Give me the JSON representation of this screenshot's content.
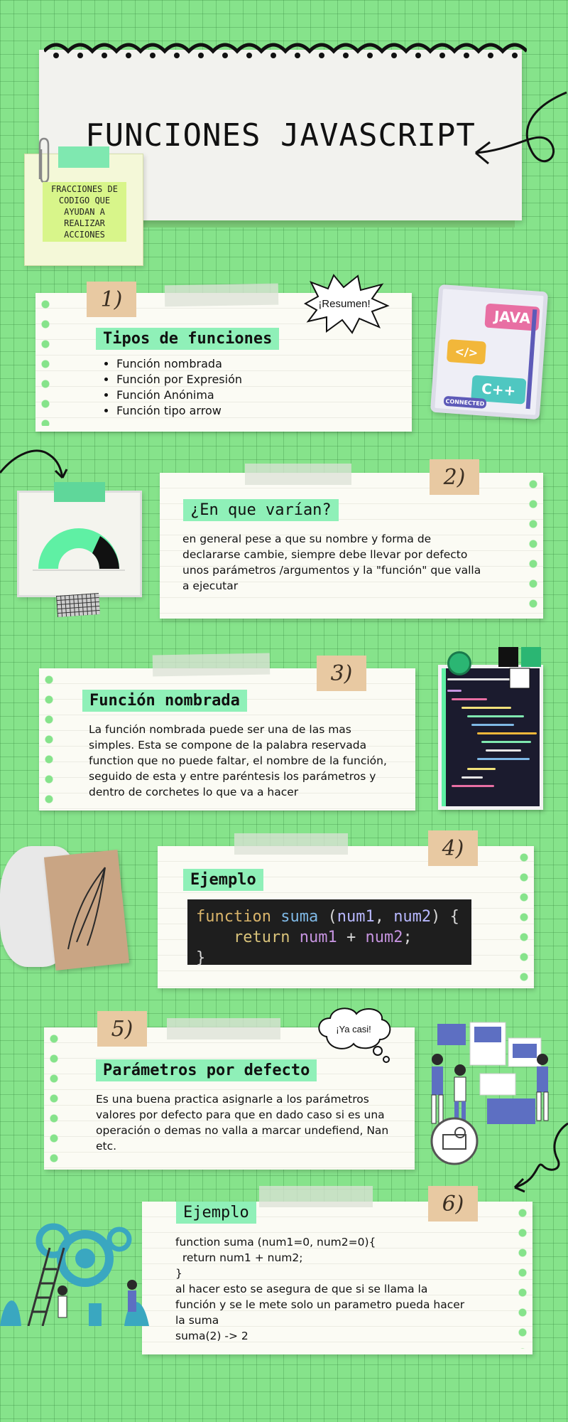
{
  "header": {
    "title": "FUNCIONES JAVASCRIPT",
    "sticky_note": "FRACCIONES DE CODIGO QUE AYUDAN A REALIZAR ACCIONES"
  },
  "section1": {
    "number": "1)",
    "burst": "¡Resumen!",
    "heading": "Tipos de funciones",
    "items": [
      "Función nombrada",
      "Función por Expresión",
      "Función Anónima",
      "Función tipo arrow"
    ],
    "illustration": {
      "chips": [
        "JAVA",
        "</>",
        "C++"
      ],
      "caption": "CONNECTED"
    }
  },
  "section2": {
    "number": "2)",
    "heading": "¿En que varían?",
    "text": "en general pese a que su nombre y forma de declararse cambie, siempre debe llevar por defecto unos parámetros /argumentos y la \"función\" que valla a ejecutar"
  },
  "section3": {
    "number": "3)",
    "heading": "Función nombrada",
    "text": "La función nombrada puede ser una de las mas simples. Esta se compone de la palabra reservada function que no puede faltar, el nombre de la función, seguido de esta y entre paréntesis los parámetros y dentro de corchetes lo que va a hacer"
  },
  "section4": {
    "number": "4)",
    "heading": "Ejemplo",
    "code": {
      "kw": "function",
      "name": "suma",
      "open": " (",
      "p1": "num1",
      "comma": ", ",
      "p2": "num2",
      "close": ") {",
      "ret": "return",
      "v1": "num1",
      "plus": " + ",
      "v2": "num2",
      "semi": ";",
      "end": "}"
    }
  },
  "section5": {
    "number": "5)",
    "bubble": "¡Ya casi!",
    "heading": "Parámetros por defecto",
    "text": "Es una buena practica asignarle a los parámetros valores por defecto para que en dado caso si es una operación o demas no valla a marcar undefiend, Nan etc."
  },
  "section6": {
    "number": "6)",
    "heading": "Ejemplo",
    "lines": [
      "function suma (num1=0, num2=0){",
      "  return num1 + num2;",
      "}",
      "al hacer esto se asegura de que si se llama la",
      "función y se le mete solo un parametro pueda hacer",
      "la suma",
      "suma(2) -> 2"
    ]
  },
  "colors": {
    "background": "#86e38b",
    "highlight": "#8ff0b8",
    "tag": "#e8c9a2",
    "paper": "#fbfbf4"
  }
}
